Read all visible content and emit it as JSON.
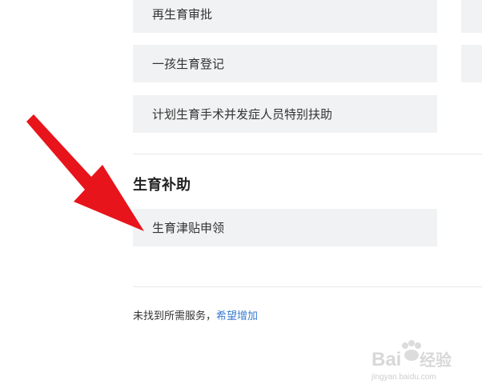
{
  "services": {
    "items": [
      {
        "label": "再生育审批"
      },
      {
        "label": "一孩生育登记"
      },
      {
        "label": "计划生育手术并发症人员特别扶助"
      }
    ]
  },
  "subsidy_section": {
    "title": "生育补助",
    "items": [
      {
        "label": "生育津贴申领"
      }
    ]
  },
  "footer": {
    "not_found_text": "未找到所需服务，",
    "request_link": "希望增加"
  },
  "annotation": {
    "arrow_color": "#e8141b",
    "arrow_icon": "red-arrow-icon"
  },
  "watermark": {
    "logo_text": "Bai",
    "logo_text_2": "经验",
    "url": "jingyan.baidu.com"
  },
  "colors": {
    "item_background": "#f1f2f3",
    "link": "#3b7ed1",
    "divider": "#e6e6e6"
  }
}
